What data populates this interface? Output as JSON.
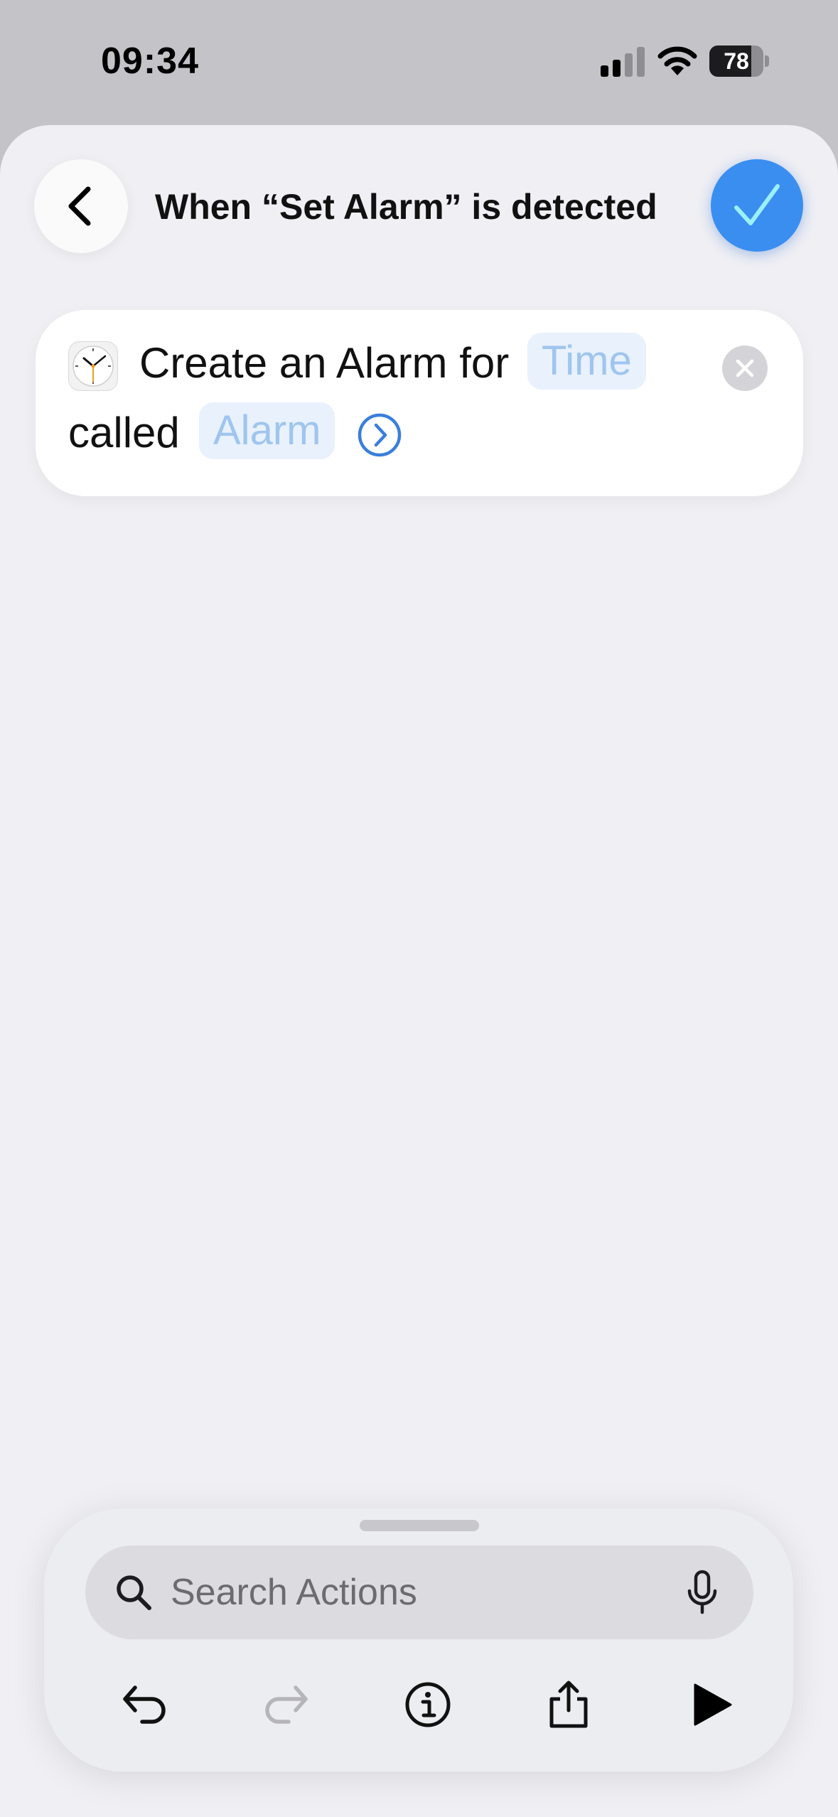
{
  "status_bar": {
    "time": "09:34",
    "battery_level": "78",
    "battery_fraction": 0.78
  },
  "header": {
    "title": "When “Set Alarm” is detected",
    "back_icon": "chevron-left-icon",
    "done_icon": "checkmark-icon"
  },
  "action": {
    "app_icon": "clock-icon",
    "prefix": "Create an Alarm for",
    "time_token": "Time",
    "called_label": "called",
    "name_token": "Alarm",
    "expand_icon": "chevron-right-circle-icon",
    "remove_icon": "close-icon"
  },
  "panel": {
    "search_placeholder": "Search Actions",
    "search_value": "",
    "toolbar": [
      "undo-icon",
      "redo-icon",
      "info-icon",
      "share-icon",
      "play-icon"
    ]
  },
  "colors": {
    "accent": "#3a8ef0",
    "token_text": "#9fc5ef",
    "token_bg": "#e8f1fc",
    "sheet_bg": "#efeff4"
  }
}
